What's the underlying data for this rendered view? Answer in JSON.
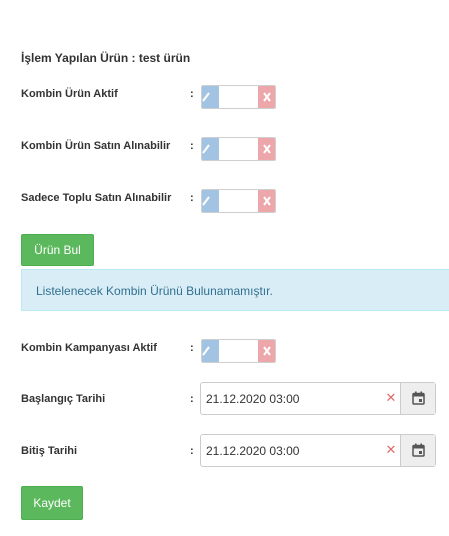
{
  "header": {
    "product_label": "İşlem Yapılan Ürün :",
    "product_value": "test ürün"
  },
  "fields": {
    "combo_active": {
      "label": "Kombin Ürün Aktif",
      "colon": ":",
      "checked": false
    },
    "combo_purchasable": {
      "label": "Kombin Ürün Satın Alınabilir",
      "colon": ":",
      "checked": false
    },
    "bulk_only": {
      "label": "Sadece Toplu Satın Alınabilir",
      "colon": ":",
      "checked": false
    },
    "campaign_active": {
      "label": "Kombin Kampanyası Aktif",
      "colon": ":",
      "checked": false
    },
    "start_date": {
      "label": "Başlangıç Tarihi",
      "colon": ":",
      "value": "21.12.2020 03:00"
    },
    "end_date": {
      "label": "Bitiş Tarihi",
      "colon": ":",
      "value": "21.12.2020 03:00"
    }
  },
  "buttons": {
    "find_product": "Ürün Bul",
    "save": "Kaydet"
  },
  "alert": {
    "message": "Listelenecek Kombin Ürünü Bulunamamıştır."
  },
  "icons": {
    "toggle_on": "check-icon",
    "toggle_off": "x-icon",
    "clear": "clear-icon",
    "calendar": "calendar-icon"
  },
  "colors": {
    "button_green": "#5cb85c",
    "alert_bg": "#d9edf7",
    "alert_text": "#31708f",
    "toggle_on": "#a2c3e2",
    "toggle_off": "#eda6a9"
  }
}
